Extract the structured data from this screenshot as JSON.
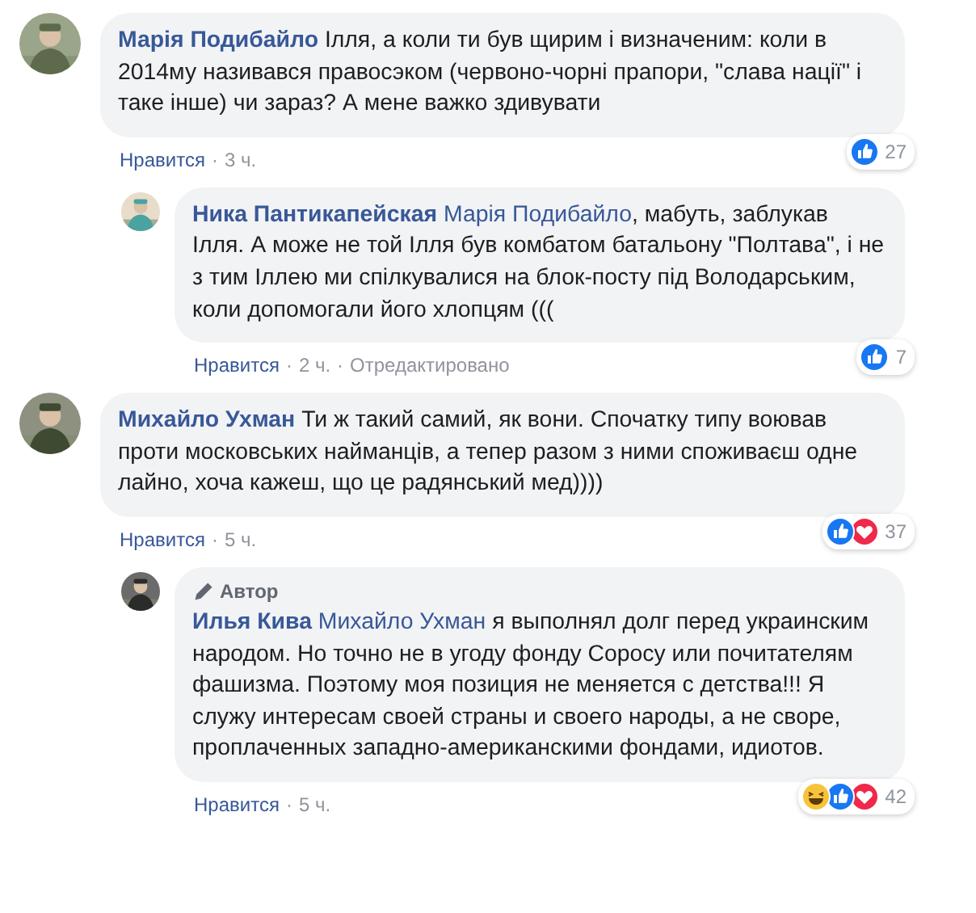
{
  "separator": "·",
  "comments": [
    {
      "author": "Марія Подибайло",
      "text": "Ілля, а коли ти був щирим і визначеним: коли в 2014му називався правосэком (червоно-чорні прапори, \"слава нації\" і таке інше) чи зараз? А мене важко здивувати",
      "reactions": [
        {
          "kind": "like"
        }
      ],
      "reaction_count": "27",
      "footer": [
        {
          "kind": "link",
          "text": "Нравится"
        },
        {
          "kind": "time",
          "text": "3 ч."
        }
      ],
      "replies": [
        {
          "author": "Ника Пантикапейская",
          "mention": "Марія Подибайло",
          "text": ", мабуть, заблукав Ілля. А може не той Ілля був комбатом батальону \"Полтава\", і не з тим Іллею ми спілкувалися на блок-посту під Володарським, коли допомогали його хлопцям (((",
          "reactions": [
            {
              "kind": "like"
            }
          ],
          "reaction_count": "7",
          "footer": [
            {
              "kind": "link",
              "text": "Нравится"
            },
            {
              "kind": "time",
              "text": "2 ч."
            },
            {
              "kind": "note",
              "text": "Отредактировано"
            }
          ]
        }
      ]
    },
    {
      "author": "Михайло Ухман",
      "text": "Ти ж такий самий, як вони. Спочатку типу воював проти московських найманців, а тепер разом з ними споживаєш одне лайно, хоча кажеш, що це радянський мед))))",
      "reactions": [
        {
          "kind": "like"
        },
        {
          "kind": "love"
        }
      ],
      "reaction_count": "37",
      "footer": [
        {
          "kind": "link",
          "text": "Нравится"
        },
        {
          "kind": "time",
          "text": "5 ч."
        }
      ],
      "replies": [
        {
          "author": "Илья Кива",
          "author_badge": "Автор",
          "mention": "Михайло Ухман",
          "text": " я выполнял долг перед украинским народом. Но точно не в угоду фонду Соросу или почитателям фашизма. Поэтому моя позиция не меняется с детства!!! Я служу интересам своей страны и своего народы, а не своре, проплаченных западно-американскими фондами, идиотов.",
          "reactions": [
            {
              "kind": "haha"
            },
            {
              "kind": "like"
            },
            {
              "kind": "love"
            }
          ],
          "reaction_count": "42",
          "footer": [
            {
              "kind": "link",
              "text": "Нравится"
            },
            {
              "kind": "time",
              "text": "5 ч."
            }
          ]
        }
      ]
    }
  ]
}
